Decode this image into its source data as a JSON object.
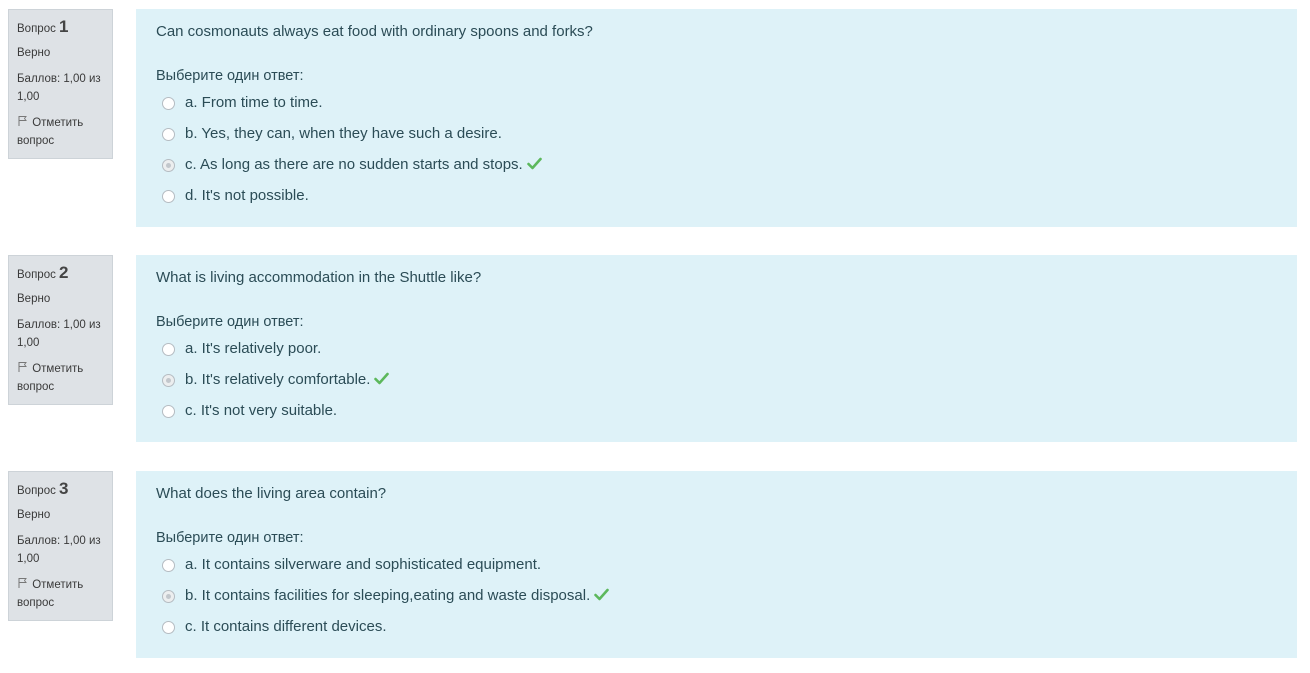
{
  "questions": [
    {
      "label": "Вопрос",
      "number": "1",
      "state": "Верно",
      "grade": "Баллов: 1,00 из 1,00",
      "flag": "Отметить вопрос",
      "text": "Can cosmonauts always eat food with ordinary spoons and forks?",
      "prompt": "Выберите один ответ:",
      "options": [
        {
          "label": "a. From time to time.",
          "selected": false
        },
        {
          "label": "b. Yes, they can, when they have such a desire.",
          "selected": false
        },
        {
          "label": "c. As long as there are no sudden starts and stops.",
          "selected": true,
          "correct": true
        },
        {
          "label": "d. It's not possible.",
          "selected": false
        }
      ]
    },
    {
      "label": "Вопрос",
      "number": "2",
      "state": "Верно",
      "grade": "Баллов: 1,00 из 1,00",
      "flag": "Отметить вопрос",
      "text": "What is living accommodation in the Shuttle like?",
      "prompt": "Выберите один ответ:",
      "options": [
        {
          "label": "a. It's relatively poor.",
          "selected": false
        },
        {
          "label": "b. It's relatively comfortable.",
          "selected": true,
          "correct": true
        },
        {
          "label": "c. It's not very suitable.",
          "selected": false
        }
      ]
    },
    {
      "label": "Вопрос",
      "number": "3",
      "state": "Верно",
      "grade": "Баллов: 1,00 из 1,00",
      "flag": "Отметить вопрос",
      "text": "What does the living area contain?",
      "prompt": "Выберите один ответ:",
      "options": [
        {
          "label": "a. It contains silverware and sophisticated equipment.",
          "selected": false
        },
        {
          "label": "b. It contains facilities for sleeping,eating and waste disposal.",
          "selected": true,
          "correct": true
        },
        {
          "label": "c. It contains different devices.",
          "selected": false
        }
      ]
    }
  ],
  "colors": {
    "content_bg": "#def2f8",
    "info_bg": "#dee2e6",
    "correct_check": "#5cb85c"
  },
  "icons": {
    "flag": "flag-icon",
    "correct": "check-icon"
  }
}
